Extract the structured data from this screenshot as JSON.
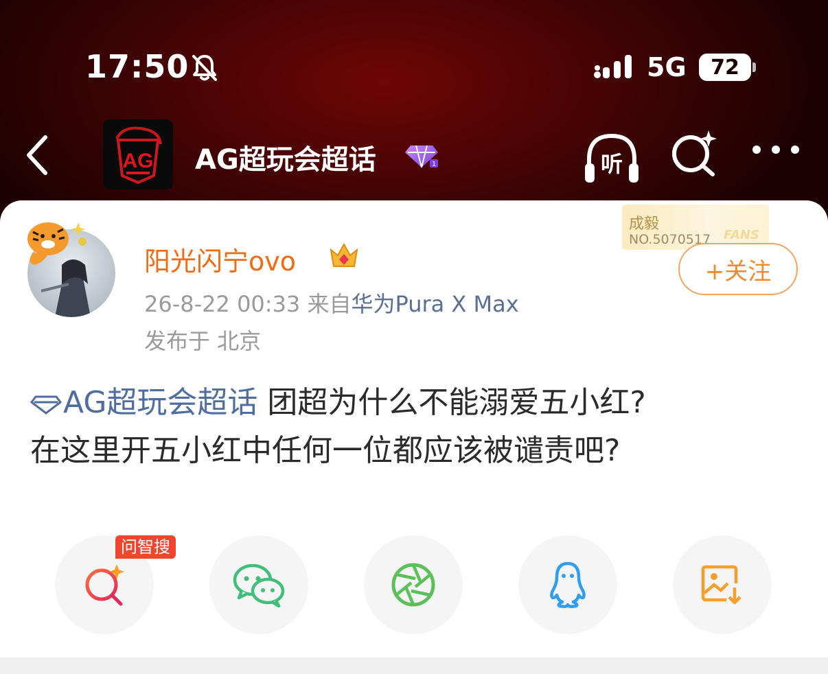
{
  "status_bar": {
    "time": "17:50",
    "network": "5G",
    "battery": "72"
  },
  "nav": {
    "topic_title": "AG超玩会超话",
    "listen_label": "听",
    "logo_text": "AG"
  },
  "post": {
    "username": "阳光闪宁ovo",
    "timestamp": "26-8-22 00:33",
    "source_prefix": "来自",
    "device": "华为Pura X Max",
    "location": "发布于 北京",
    "fans_badge_name": "成毅",
    "fans_badge_no": "NO.5070517",
    "fans_badge_word": "FANS",
    "follow_label": "+关注",
    "topic_link": "AG超玩会超话",
    "text_line1": " 团超为什么不能溺爱五小红?",
    "text_line2": "在这里开五小红中任何一位都应该被谴责吧?"
  },
  "share": {
    "search_tag": "问智搜",
    "items": [
      "search",
      "wechat",
      "moments",
      "qq",
      "save-image"
    ]
  },
  "colors": {
    "header_red": "#6e0606",
    "username_orange": "#f26a12",
    "link_blue": "#4f6e9f",
    "follow_orange": "#f28a2c"
  }
}
